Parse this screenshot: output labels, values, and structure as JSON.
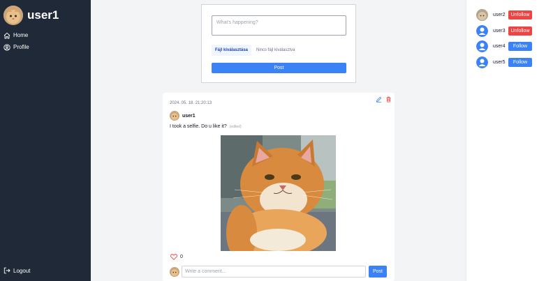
{
  "sidebar": {
    "username": "user1",
    "nav": [
      {
        "label": "Home",
        "icon": "home-icon"
      },
      {
        "label": "Profile",
        "icon": "user-circle-icon"
      }
    ],
    "logout_label": "Logout"
  },
  "composer": {
    "placeholder": "What's happening?",
    "file_button_label": "Fájl kiválasztása",
    "file_status": "Nincs fájl kiválasztva",
    "post_label": "Post"
  },
  "post": {
    "date": "2024. 05. 18. 21:20:13",
    "author": "user1",
    "text": "I took a selfie. Do u like it?",
    "edited_label": "(edited)",
    "like_count": "0",
    "comment_placeholder": "Write a comment...",
    "comment_post_label": "Post"
  },
  "users": [
    {
      "name": "user2",
      "action": "Unfollow",
      "avatar": "cat-photo"
    },
    {
      "name": "user3",
      "action": "Unfollow",
      "avatar": "default-user-icon"
    },
    {
      "name": "user4",
      "action": "Follow",
      "avatar": "default-user-icon"
    },
    {
      "name": "user5",
      "action": "Follow",
      "avatar": "default-user-icon"
    }
  ],
  "colors": {
    "sidebar_bg": "#1f2937",
    "primary": "#3b82f6",
    "danger": "#ef4444",
    "page_bg": "#f3f4f6"
  }
}
